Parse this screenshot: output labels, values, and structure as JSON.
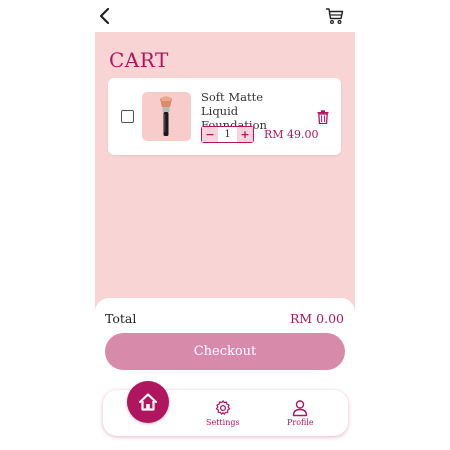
{
  "header": {
    "back_icon": "chevron-left-icon",
    "cart_icon": "shopping-cart-icon"
  },
  "page": {
    "title": "CART"
  },
  "cart": {
    "items": [
      {
        "name": "Soft Matte Liquid Foundation",
        "quantity": "1",
        "price": "RM 49.00",
        "checked": false,
        "image_icon": "makeup-brush-icon",
        "decrement_label": "−",
        "increment_label": "+"
      }
    ]
  },
  "summary": {
    "total_label": "Total",
    "total_value": "RM 0.00",
    "checkout_label": "Checkout"
  },
  "bottom_nav": {
    "home_icon": "home-icon",
    "settings_label": "Settings",
    "profile_label": "Profile"
  },
  "colors": {
    "accent": "#b0155f",
    "background": "#f9d4d4",
    "checkout_button": "#d88aab"
  }
}
